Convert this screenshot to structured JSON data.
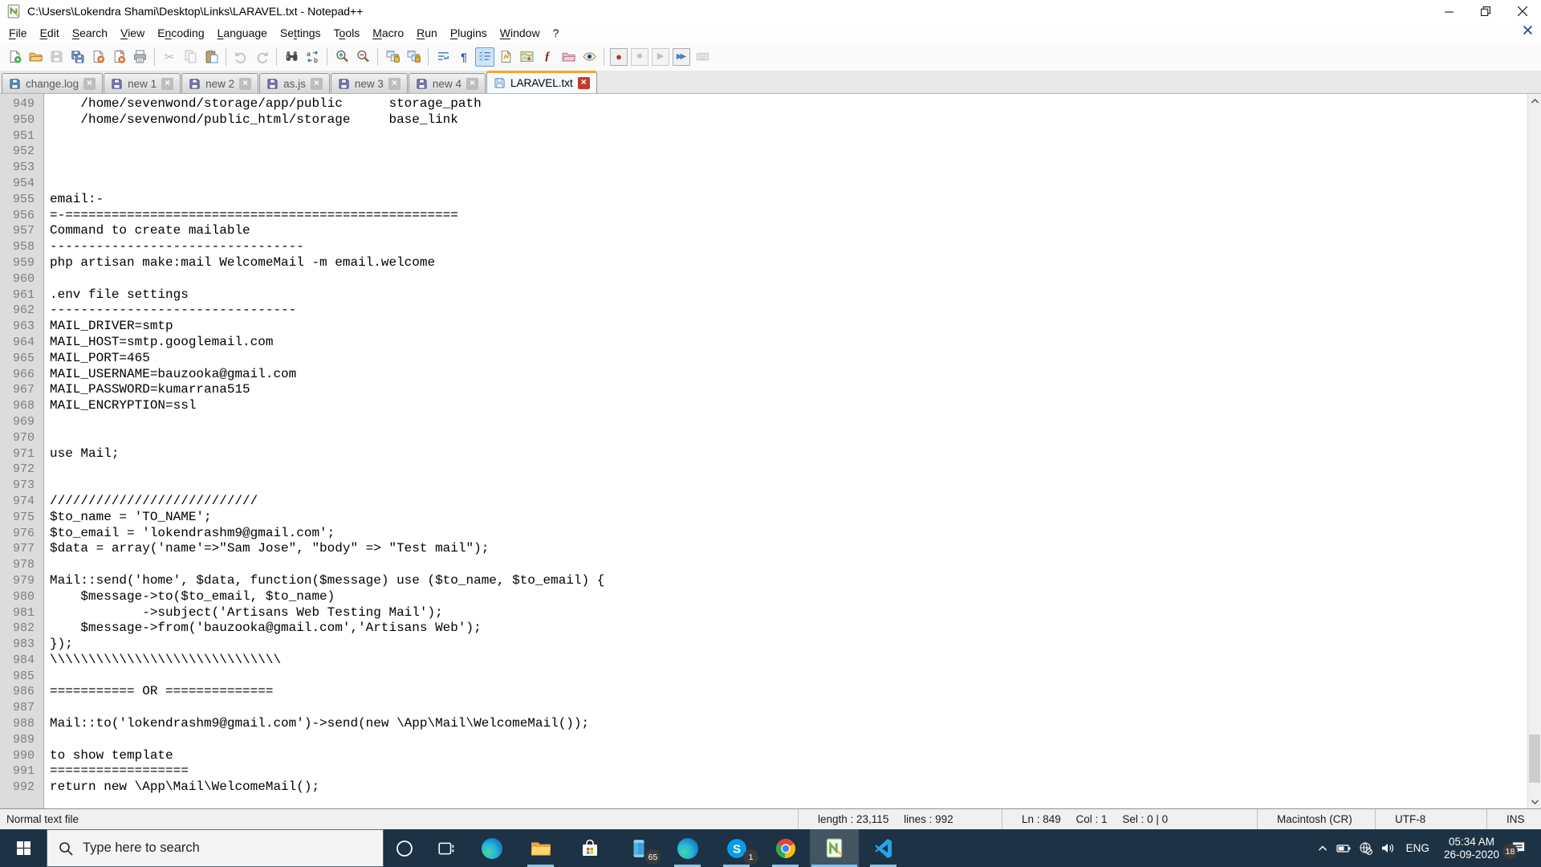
{
  "window": {
    "title": "C:\\Users\\Lokendra Shami\\Desktop\\Links\\LARAVEL.txt - Notepad++"
  },
  "menu": {
    "items": [
      {
        "label": "File",
        "u": 0
      },
      {
        "label": "Edit",
        "u": 0
      },
      {
        "label": "Search",
        "u": 0
      },
      {
        "label": "View",
        "u": 0
      },
      {
        "label": "Encoding",
        "u": 1
      },
      {
        "label": "Language",
        "u": 0
      },
      {
        "label": "Settings",
        "u": 2
      },
      {
        "label": "Tools",
        "u": 1
      },
      {
        "label": "Macro",
        "u": 0
      },
      {
        "label": "Run",
        "u": 0
      },
      {
        "label": "Plugins",
        "u": 0
      },
      {
        "label": "Window",
        "u": 0
      },
      {
        "label": "?",
        "u": -1
      }
    ]
  },
  "toolbar": {
    "groups": [
      [
        {
          "name": "new-file"
        },
        {
          "name": "open-file"
        },
        {
          "name": "save-file",
          "disabled": true
        },
        {
          "name": "save-all"
        },
        {
          "name": "close-file"
        },
        {
          "name": "close-all"
        },
        {
          "name": "print"
        }
      ],
      [
        {
          "name": "cut",
          "disabled": true
        },
        {
          "name": "copy",
          "disabled": true
        },
        {
          "name": "paste"
        }
      ],
      [
        {
          "name": "undo",
          "disabled": true
        },
        {
          "name": "redo",
          "disabled": true
        }
      ],
      [
        {
          "name": "find"
        },
        {
          "name": "replace"
        }
      ],
      [
        {
          "name": "zoom-in"
        },
        {
          "name": "zoom-out"
        }
      ],
      [
        {
          "name": "sync-vertical"
        },
        {
          "name": "sync-horizontal"
        }
      ],
      [
        {
          "name": "word-wrap"
        },
        {
          "name": "show-all-characters"
        },
        {
          "name": "show-indent-guide",
          "active": true
        },
        {
          "name": "document-map"
        },
        {
          "name": "function-list"
        },
        {
          "name": "plugin-panel"
        },
        {
          "name": "folder-as-workspace"
        },
        {
          "name": "monitoring"
        }
      ],
      [
        {
          "name": "macro-record",
          "boxed": true
        },
        {
          "name": "macro-stop",
          "boxed": true,
          "disabled": true
        },
        {
          "name": "macro-play",
          "boxed": true,
          "disabled": true
        },
        {
          "name": "macro-run-multiple",
          "boxed": true
        },
        {
          "name": "macro-save",
          "disabled": true
        }
      ]
    ]
  },
  "tabs": [
    {
      "label": "change.log",
      "icon_fill": "#4f96c8",
      "icon_stroke": "#2d5f8a",
      "active": false
    },
    {
      "label": "new 1",
      "icon_fill": "#7e7ec0",
      "icon_stroke": "#4a4a8a",
      "active": false
    },
    {
      "label": "new 2",
      "icon_fill": "#7e7ec0",
      "icon_stroke": "#4a4a8a",
      "active": false
    },
    {
      "label": "as.js",
      "icon_fill": "#7e7ec0",
      "icon_stroke": "#4a4a8a",
      "active": false
    },
    {
      "label": "new 3",
      "icon_fill": "#7e7ec0",
      "icon_stroke": "#4a4a8a",
      "active": false
    },
    {
      "label": "new 4",
      "icon_fill": "#7e7ec0",
      "icon_stroke": "#4a4a8a",
      "active": false
    },
    {
      "label": "LARAVEL.txt",
      "icon_fill": "#d6e9f8",
      "icon_stroke": "#5a8ac0",
      "active": true
    }
  ],
  "editor": {
    "first_line": 949,
    "lines": [
      "    /home/sevenwond/storage/app/public      storage_path",
      "    /home/sevenwond/public_html/storage     base_link",
      "",
      "",
      "",
      "",
      "email:-",
      "=-===================================================",
      "Command to create mailable",
      "---------------------------------",
      "php artisan make:mail WelcomeMail -m email.welcome",
      "",
      ".env file settings",
      "--------------------------------",
      "MAIL_DRIVER=smtp",
      "MAIL_HOST=smtp.googlemail.com",
      "MAIL_PORT=465",
      "MAIL_USERNAME=bauzooka@gmail.com",
      "MAIL_PASSWORD=kumarrana515",
      "MAIL_ENCRYPTION=ssl",
      "",
      "",
      "use Mail;",
      "",
      "",
      "///////////////////////////",
      "$to_name = 'TO_NAME';",
      "$to_email = 'lokendrashm9@gmail.com';",
      "$data = array('name'=>\"Sam Jose\", \"body\" => \"Test mail\");",
      "",
      "Mail::send('home', $data, function($message) use ($to_name, $to_email) {",
      "    $message->to($to_email, $to_name)",
      "            ->subject('Artisans Web Testing Mail');",
      "    $message->from('bauzooka@gmail.com','Artisans Web');",
      "});",
      "\\\\\\\\\\\\\\\\\\\\\\\\\\\\\\\\\\\\\\\\\\\\\\\\\\\\\\\\\\\\",
      "",
      "=========== OR ==============",
      "",
      "Mail::to('lokendrashm9@gmail.com')->send(new \\App\\Mail\\WelcomeMail());",
      "",
      "to show template",
      "==================",
      "return new \\App\\Mail\\WelcomeMail();"
    ]
  },
  "status_bar": {
    "doc_type": "Normal text file",
    "length_lines": "length : 23,115     lines : 992",
    "position": "Ln : 849     Col : 1     Sel : 0 | 0",
    "eol": "Macintosh (CR)",
    "encoding": "UTF-8",
    "mode": "INS"
  },
  "taskbar": {
    "search_placeholder": "Type here to search",
    "apps": [
      {
        "name": "edge",
        "running": false
      },
      {
        "name": "file-explorer",
        "running": true
      },
      {
        "name": "microsoft-store",
        "running": false
      },
      {
        "name": "your-phone",
        "badge": "65",
        "running": false
      },
      {
        "name": "edge-beta",
        "running": true
      },
      {
        "name": "skype",
        "badge": "1",
        "running": true
      },
      {
        "name": "chrome",
        "running": true
      },
      {
        "name": "notepad-plus-plus",
        "running": true,
        "active": true
      },
      {
        "name": "vscode",
        "running": true
      }
    ],
    "tray": {
      "language": "ENG",
      "time": "05:34 AM",
      "date": "26-09-2020",
      "notification_badge": "18"
    }
  }
}
